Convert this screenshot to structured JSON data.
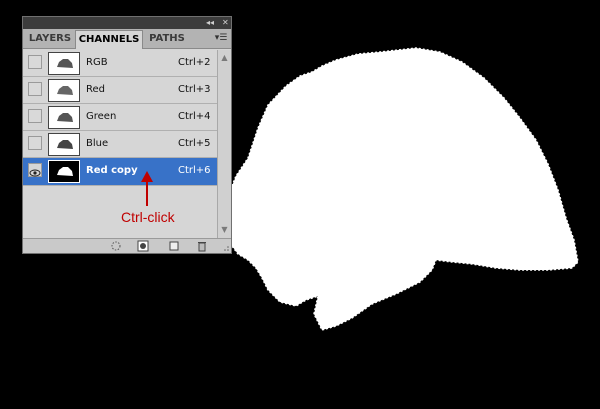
{
  "panel": {
    "tabs": [
      {
        "label": "LAYERS",
        "active": false
      },
      {
        "label": "CHANNELS",
        "active": true
      },
      {
        "label": "PATHS",
        "active": false
      }
    ],
    "channels": [
      {
        "name": "RGB",
        "shortcut": "Ctrl+2",
        "visible": false,
        "selected": false
      },
      {
        "name": "Red",
        "shortcut": "Ctrl+3",
        "visible": false,
        "selected": false
      },
      {
        "name": "Green",
        "shortcut": "Ctrl+4",
        "visible": false,
        "selected": false
      },
      {
        "name": "Blue",
        "shortcut": "Ctrl+5",
        "visible": false,
        "selected": false
      },
      {
        "name": "Red copy",
        "shortcut": "Ctrl+6",
        "visible": true,
        "selected": true
      }
    ],
    "icons": {
      "collapse": "double-left-arrow-icon",
      "close": "close-icon",
      "menu": "panel-menu-icon",
      "bottom": [
        "load-selection-icon",
        "save-selection-as-channel-icon",
        "new-channel-icon",
        "delete-channel-icon"
      ]
    }
  },
  "annotation": {
    "text": "Ctrl-click",
    "color": "#c00000"
  },
  "colors": {
    "selection": "#3872c8",
    "panel_bg": "#d6d6d6",
    "canvas_bg": "#000000"
  }
}
